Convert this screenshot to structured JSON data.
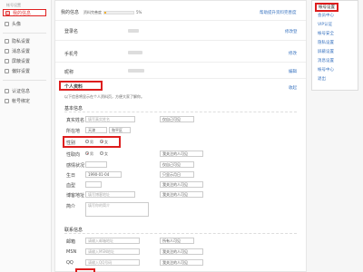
{
  "sidebar": {
    "header": "帐号设置",
    "items": [
      {
        "label": "我的信息",
        "active": true
      },
      {
        "label": "头像"
      },
      {
        "label": "隐私设置"
      },
      {
        "label": "消息设置"
      },
      {
        "label": "屏蔽设置"
      },
      {
        "label": "偏好设置"
      },
      {
        "label": "认证信息"
      },
      {
        "label": "帐号绑定"
      }
    ]
  },
  "header": {
    "title": "我的信息",
    "completion_label": "资料完善度",
    "completion_percent": "5%",
    "completion_fraction": 0.05,
    "link": "帮助提升资料完善度"
  },
  "account_rows": [
    {
      "label": "登录名",
      "action": "修改登"
    },
    {
      "label": "手机号",
      "action": "修改"
    },
    {
      "label": "昵称",
      "action": "编辑"
    }
  ],
  "profile": {
    "title": "个人资料",
    "collapse": "收起",
    "hint": "以下信息将显示在个人资料页，方便大家了解你。",
    "basic_section": "基本信息",
    "real_name_label": "真实姓名",
    "real_name_placeholder": "填写真实姓名",
    "visibility_self": "仅自己可见",
    "location_label": "所在地",
    "location_province": "天津",
    "location_city": "和平区",
    "gender_label": "性别",
    "gender_male": "男",
    "gender_female": "女",
    "orientation_label": "性取向",
    "orientation_opt1": "男",
    "orientation_opt2": "女",
    "visibility_follow": "我关注的人可见",
    "relationship_label": "感情状况",
    "birthday_label": "生日",
    "birthday_value": "1990-01-04",
    "visibility_month_day": "只显示月日",
    "blood_label": "血型",
    "blog_label": "博客地址",
    "blog_placeholder": "填写博客地址",
    "intro_label": "简介",
    "intro_placeholder": "填写你的简介"
  },
  "contact": {
    "section": "联系信息",
    "email_label": "邮箱",
    "email_placeholder": "请输入邮箱地址",
    "msn_label": "MSN",
    "msn_placeholder": "请输入MSN地址",
    "qq_label": "QQ",
    "qq_placeholder": "请输入QQ号码",
    "vis_all": "所有人可见",
    "vis_follow": "我关注的人可见"
  },
  "menu": {
    "items": [
      {
        "label": "帐号设置",
        "active": true
      },
      {
        "label": "会员中心"
      },
      {
        "label": "VIP认证"
      },
      {
        "label": "帐号安全"
      },
      {
        "label": "隐私设置"
      },
      {
        "label": "屏蔽设置"
      },
      {
        "label": "消息设置"
      },
      {
        "label": "帐号中心"
      },
      {
        "label": "退出"
      }
    ]
  },
  "colors": {
    "accent": "#dd1e1e",
    "link": "#3a74c0",
    "progress": "#f2b233"
  }
}
